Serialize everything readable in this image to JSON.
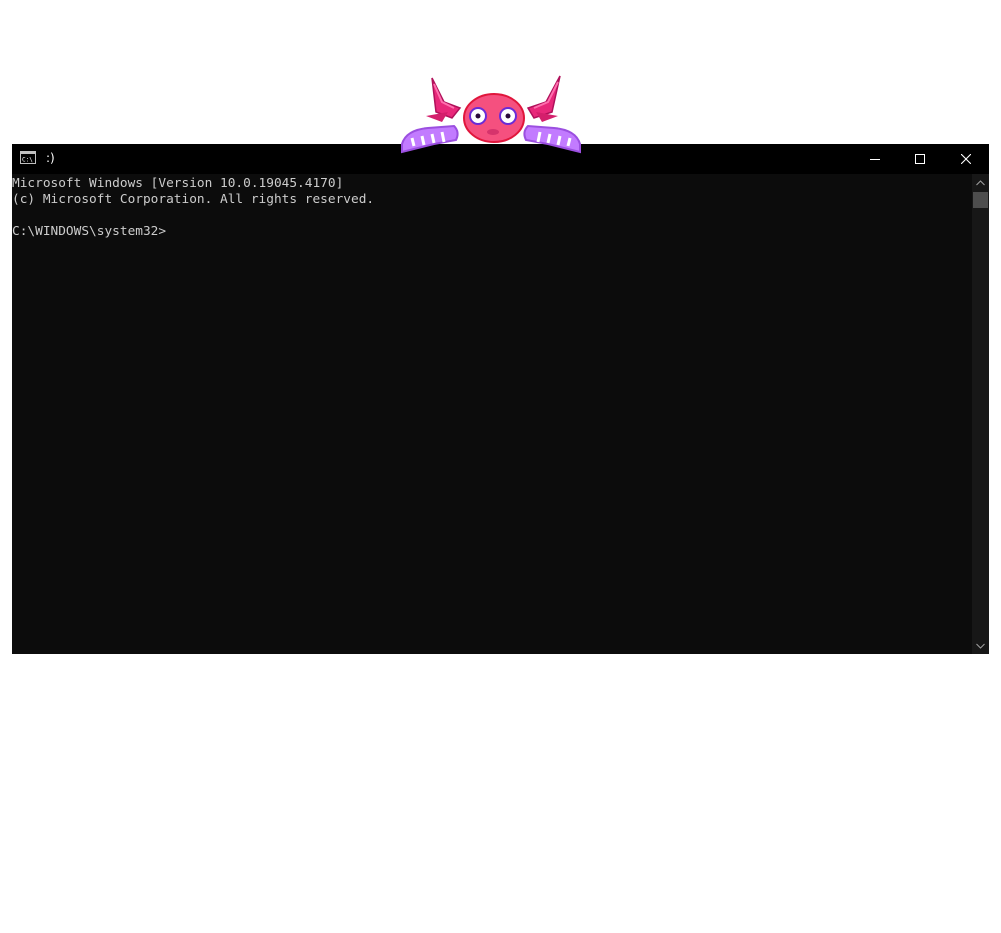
{
  "window": {
    "title": ":)",
    "app_icon": "cmd-icon",
    "controls": {
      "minimize_icon": "minimize-icon",
      "maximize_icon": "maximize-icon",
      "close_icon": "close-icon"
    }
  },
  "console": {
    "lines": [
      "Microsoft Windows [Version 10.0.19045.4170]",
      "(c) Microsoft Corporation. All rights reserved.",
      "",
      "C:\\WINDOWS\\system32>"
    ]
  },
  "mascot": {
    "icon": "axolotl-mascot-icon"
  },
  "colors": {
    "console_background": "#0c0c0c",
    "titlebar_background": "#000000",
    "console_text": "#cccccc",
    "page_background": "#ffffff"
  }
}
